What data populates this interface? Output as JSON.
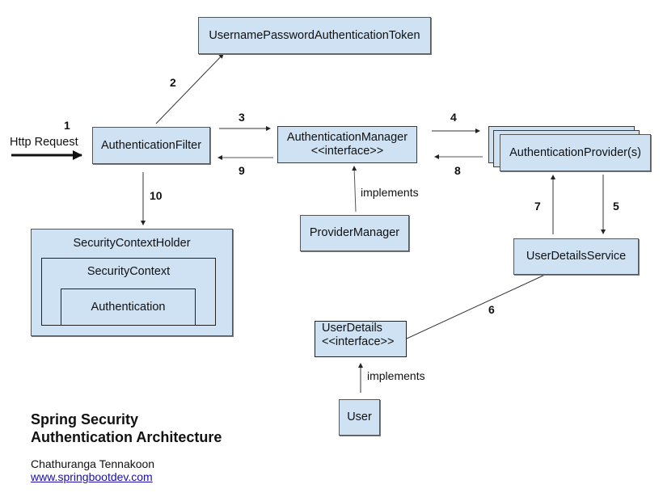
{
  "diagram": {
    "boxes": {
      "token": "UsernamePasswordAuthenticationToken",
      "filter": "AuthenticationFilter",
      "manager_line1": "AuthenticationManager",
      "manager_line2": "<<interface>>",
      "provider": "AuthenticationProvider(s)",
      "provider_manager": "ProviderManager",
      "user_details_service": "UserDetailsService",
      "security_context_holder": "SecurityContextHolder",
      "security_context": "SecurityContext",
      "authentication": "Authentication",
      "user_details_line1": "UserDetails",
      "user_details_line2": "<<interface>>",
      "user": "User"
    },
    "labels": {
      "http_request": "Http Request",
      "implements_manager": "implements",
      "implements_user": "implements"
    },
    "steps": {
      "s1": "1",
      "s2": "2",
      "s3": "3",
      "s4": "4",
      "s5": "5",
      "s6": "6",
      "s7": "7",
      "s8": "8",
      "s9": "9",
      "s10": "10"
    },
    "colors": {
      "box_fill": "#cfe2f3",
      "box_border": "#3b3b3b",
      "link": "#1a0dab"
    }
  },
  "footer": {
    "title_line1": "Spring Security",
    "title_line2": "Authentication Architecture",
    "author": "Chathuranga Tennakoon",
    "website": "www.springbootdev.com"
  }
}
